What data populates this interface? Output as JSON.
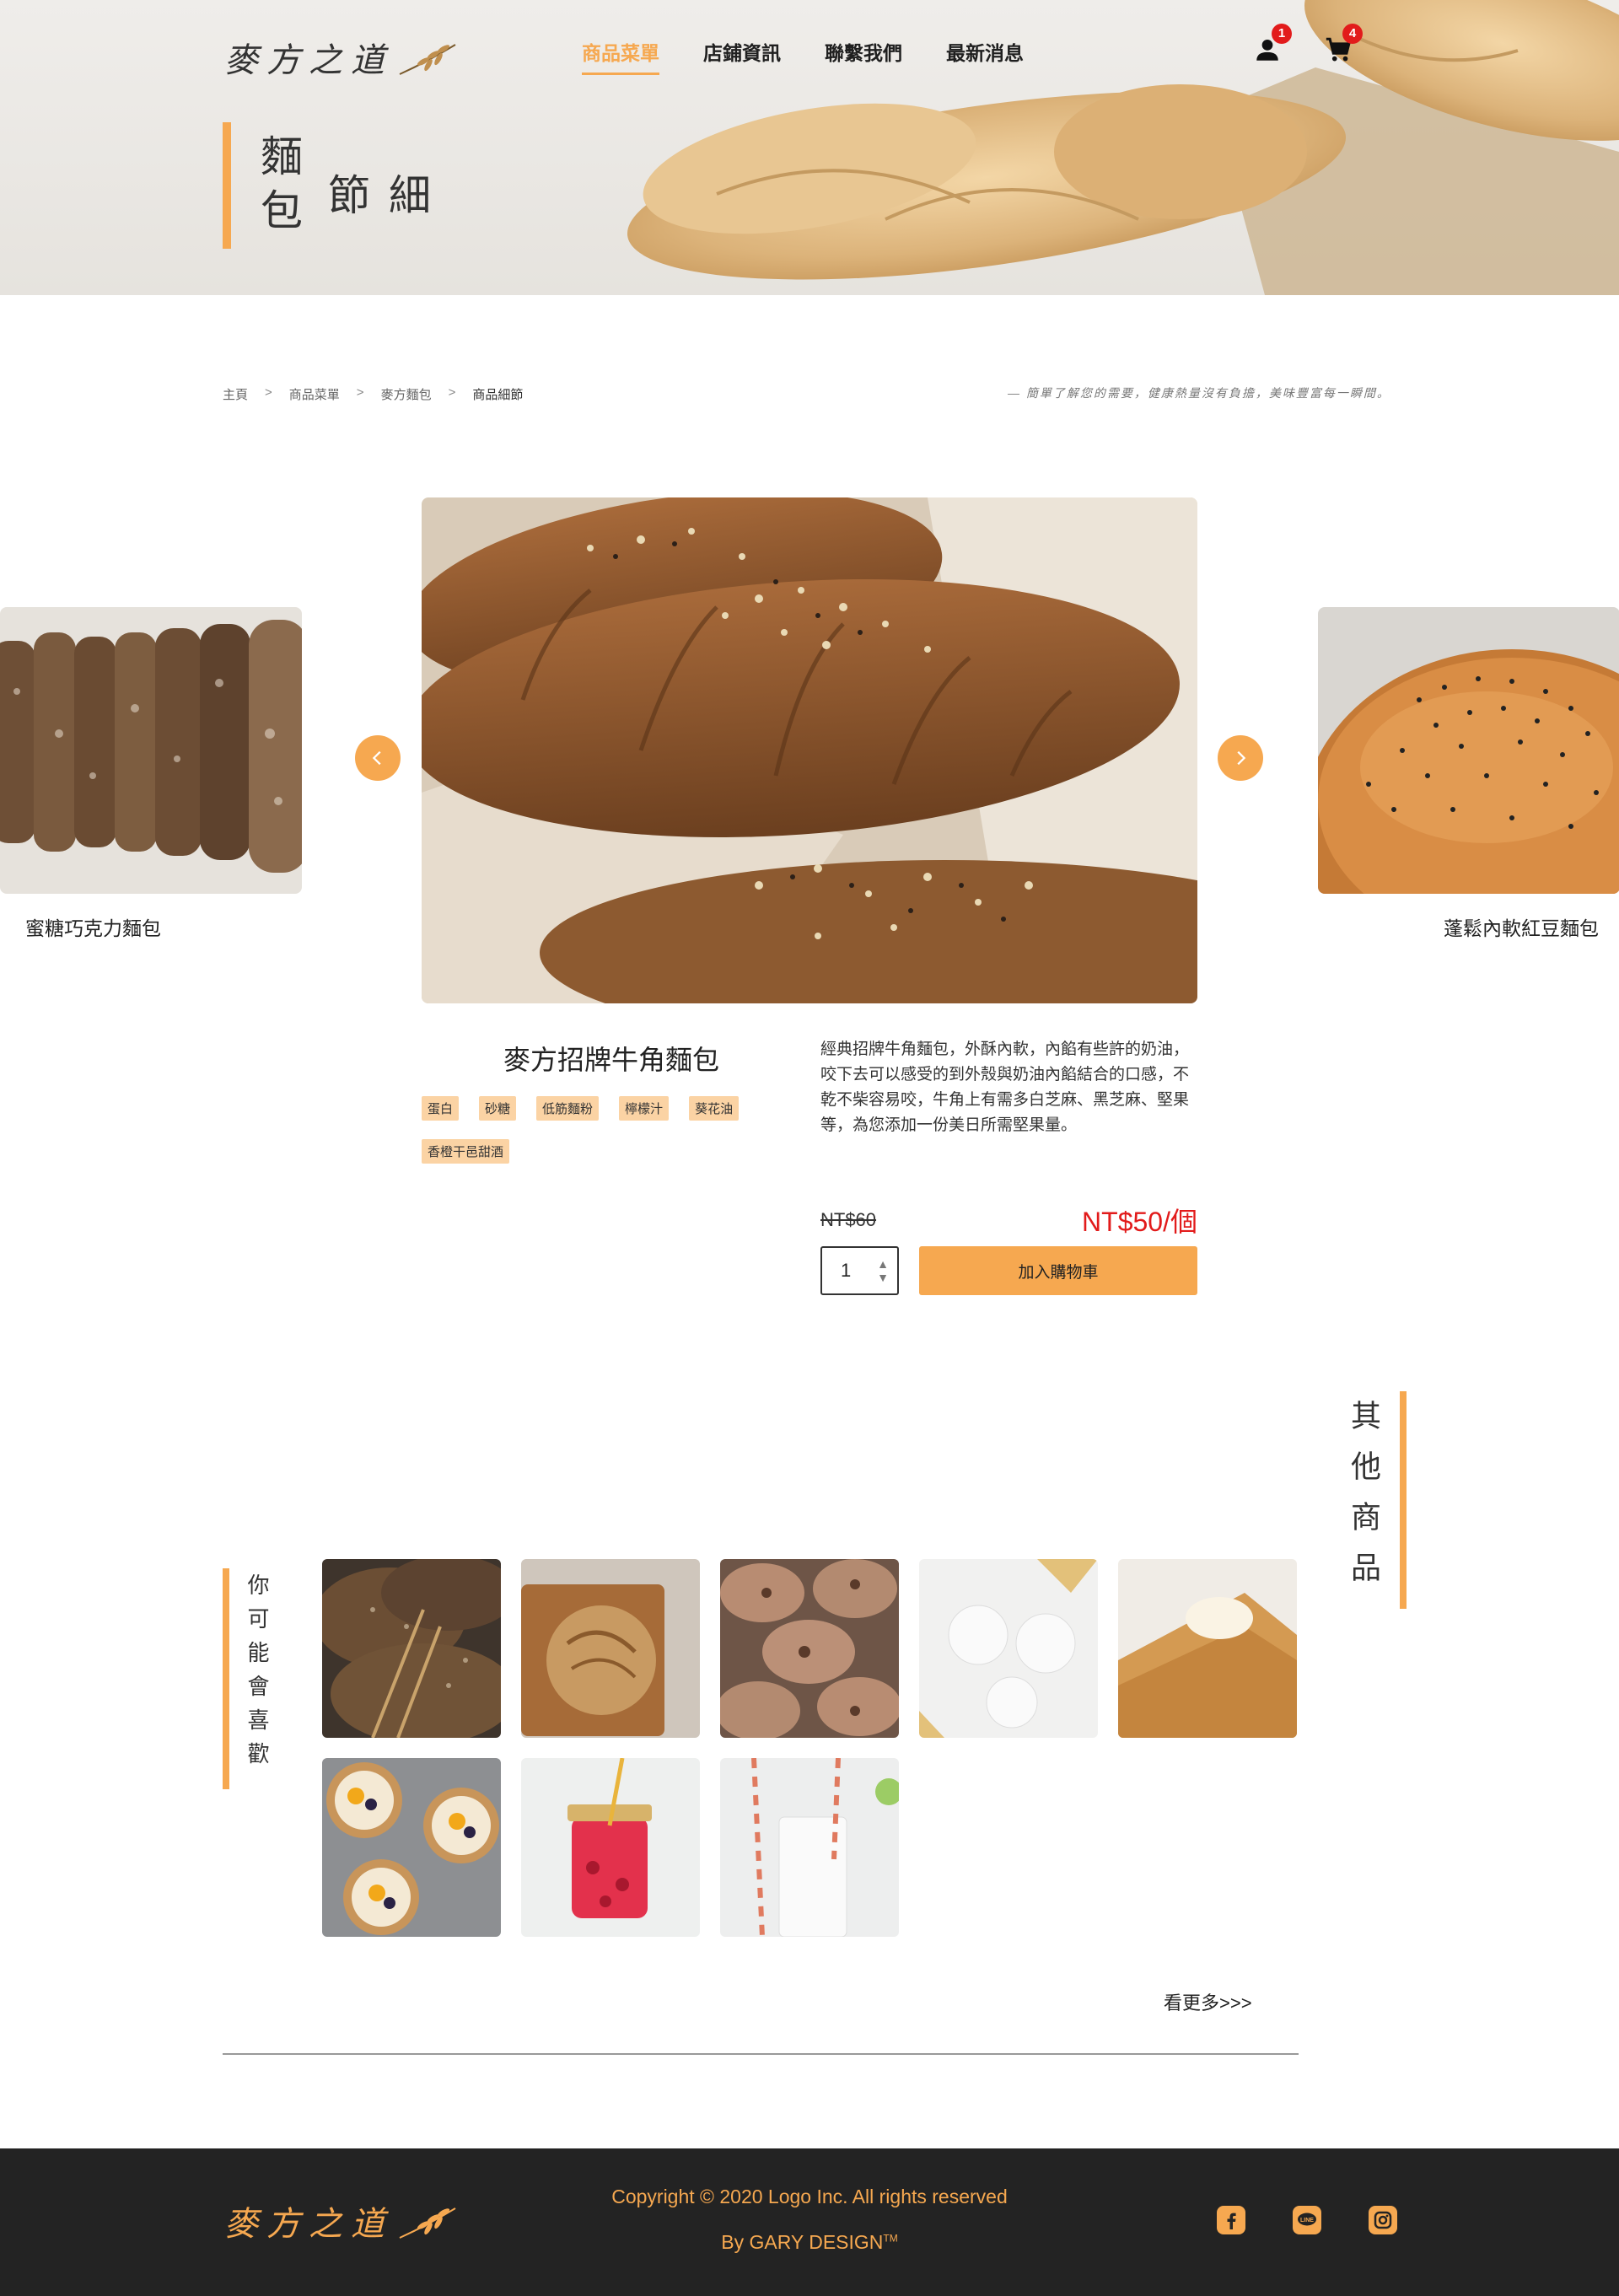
{
  "brand": {
    "name": "麥方之道"
  },
  "nav": {
    "items": [
      "商品菜單",
      "店鋪資訊",
      "聯繫我們",
      "最新消息"
    ],
    "active_index": 0
  },
  "header": {
    "user_badge": "1",
    "cart_badge": "4"
  },
  "page_title": {
    "line1": "麵包",
    "line2": "細節"
  },
  "breadcrumb": {
    "items": [
      "主頁",
      "商品菜單",
      "麥方麵包",
      "商品細節"
    ],
    "separator": ">"
  },
  "slogan": "— 簡單了解您的需要，健康熱量沒有負擔，美味豐富每一瞬間。",
  "carousel": {
    "prev_label": "蜜糖巧克力麵包",
    "next_label": "蓬鬆內軟紅豆麵包"
  },
  "product": {
    "name": "麥方招牌牛角麵包",
    "tags": [
      "蛋白",
      "砂糖",
      "低筋麵粉",
      "檸檬汁",
      "葵花油",
      "香橙干邑甜酒"
    ],
    "description": "經典招牌牛角麵包，外酥內軟，內餡有些許的奶油，咬下去可以感受的到外殼與奶油內餡結合的口感，不乾不柴容易咬，牛角上有需多白芝麻、黑芝麻、堅果等，為您添加一份美日所需堅果量。",
    "old_price": "NT$60",
    "new_price": "NT$50/個",
    "quantity": "1",
    "add_to_cart": "加入購物車"
  },
  "other_section": {
    "title": "其他商品"
  },
  "like_section": {
    "title": "你可能會喜歡"
  },
  "see_more": "看更多>>>",
  "footer": {
    "copyright": "Copyright © 2020 Logo Inc. All rights reserved",
    "byline": "By GARY DESIGN",
    "byline_tm": "TM"
  },
  "colors": {
    "accent": "#f6a850",
    "price_red": "#e21b1b",
    "footer_bg": "#232323"
  },
  "icons": [
    "user-icon",
    "cart-icon",
    "chevron-left-icon",
    "chevron-right-icon",
    "facebook-icon",
    "line-icon",
    "instagram-icon"
  ]
}
